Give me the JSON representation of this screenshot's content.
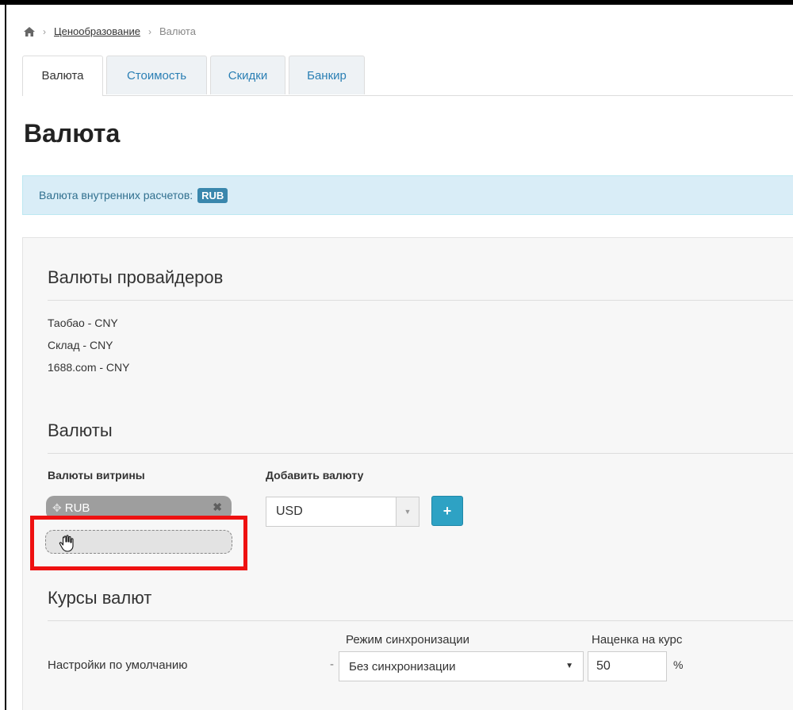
{
  "breadcrumb": {
    "home_icon": "home-icon",
    "link": "Ценообразование",
    "current": "Валюта",
    "separator": "›"
  },
  "tabs": [
    {
      "label": "Валюта",
      "active": true
    },
    {
      "label": "Стоимость",
      "active": false
    },
    {
      "label": "Скидки",
      "active": false
    },
    {
      "label": "Банкир",
      "active": false
    }
  ],
  "page_title": "Валюта",
  "info": {
    "text": "Валюта внутренних расчетов:",
    "badge": "RUB"
  },
  "providers": {
    "title": "Валюты провайдеров",
    "items": [
      "Таобао - CNY",
      "Склад - CNY",
      "1688.com - CNY"
    ]
  },
  "currencies": {
    "title": "Валюты",
    "storefront_label": "Валюты витрины",
    "storefront_chip": "RUB",
    "add_label": "Добавить валюту",
    "add_select_value": "USD",
    "add_button": "+"
  },
  "rates": {
    "title": "Курсы валют",
    "sync_header": "Режим синхронизации",
    "markup_header": "Наценка на курс",
    "row_label": "Настройки по умолчанию",
    "dash": "-",
    "sync_value": "Без синхронизации",
    "markup_value": "50",
    "percent": "%"
  },
  "colors": {
    "accent": "#2ea2c4",
    "info_bg": "#d9edf7",
    "highlight": "#ee1111",
    "tab_link": "#2a7fb4"
  }
}
